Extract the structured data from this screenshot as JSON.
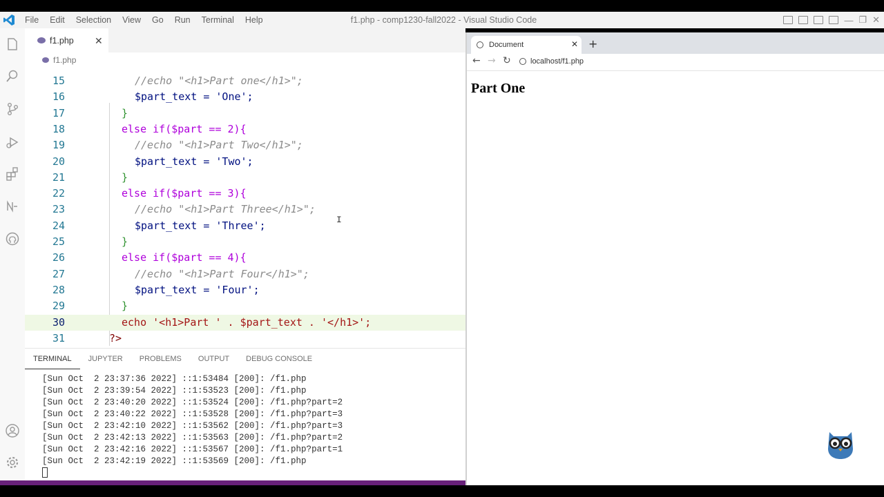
{
  "titlebar": {
    "menu": [
      "File",
      "Edit",
      "Selection",
      "View",
      "Go",
      "Run",
      "Terminal",
      "Help"
    ],
    "title": "f1.php - comp1230-fall2022 - Visual Studio Code"
  },
  "activitybar": {
    "icons": [
      "explorer-icon",
      "search-icon",
      "source-control-icon",
      "run-debug-icon",
      "extensions-icon",
      "n-icon",
      "github-icon",
      "account-icon",
      "gear-icon"
    ]
  },
  "editor": {
    "tab_label": "f1.php",
    "breadcrumb": "f1.php",
    "active_line": "30",
    "lines": [
      {
        "n": "15",
        "text": "//echo \"<h1>Part one</h1>\";"
      },
      {
        "n": "16",
        "text": "$part_text = 'One';"
      },
      {
        "n": "17",
        "text": "}"
      },
      {
        "n": "18",
        "text": "else if($part == 2){"
      },
      {
        "n": "19",
        "text": "//echo \"<h1>Part Two</h1>\";"
      },
      {
        "n": "20",
        "text": "$part_text = 'Two';"
      },
      {
        "n": "21",
        "text": "}"
      },
      {
        "n": "22",
        "text": "else if($part == 3){"
      },
      {
        "n": "23",
        "text": "//echo \"<h1>Part Three</h1>\";"
      },
      {
        "n": "24",
        "text": "$part_text = 'Three';"
      },
      {
        "n": "25",
        "text": "}"
      },
      {
        "n": "26",
        "text": "else if($part == 4){"
      },
      {
        "n": "27",
        "text": "//echo \"<h1>Part Four</h1>\";"
      },
      {
        "n": "28",
        "text": "$part_text = 'Four';"
      },
      {
        "n": "29",
        "text": "}"
      },
      {
        "n": "30",
        "text": "echo '<h1>Part ' . $part_text . '</h1>';"
      },
      {
        "n": "31",
        "text": "?>"
      }
    ]
  },
  "panel": {
    "tabs": [
      "TERMINAL",
      "JUPYTER",
      "PROBLEMS",
      "OUTPUT",
      "DEBUG CONSOLE"
    ],
    "active_tab": "TERMINAL",
    "terminal_lines": [
      "[Sun Oct  2 23:37:36 2022] ::1:53484 [200]: /f1.php",
      "[Sun Oct  2 23:39:54 2022] ::1:53523 [200]: /f1.php",
      "[Sun Oct  2 23:40:20 2022] ::1:53524 [200]: /f1.php?part=2",
      "[Sun Oct  2 23:40:22 2022] ::1:53528 [200]: /f1.php?part=3",
      "[Sun Oct  2 23:42:10 2022] ::1:53562 [200]: /f1.php?part=3",
      "[Sun Oct  2 23:42:13 2022] ::1:53563 [200]: /f1.php?part=2",
      "[Sun Oct  2 23:42:16 2022] ::1:53567 [200]: /f1.php?part=1",
      "[Sun Oct  2 23:42:19 2022] ::1:53569 [200]: /f1.php"
    ]
  },
  "browser": {
    "tab_title": "Document",
    "url": "localhost/f1.php",
    "page_heading": "Part One"
  },
  "colors": {
    "statusbar": "#68217a",
    "current_line": "#eff8e4"
  }
}
